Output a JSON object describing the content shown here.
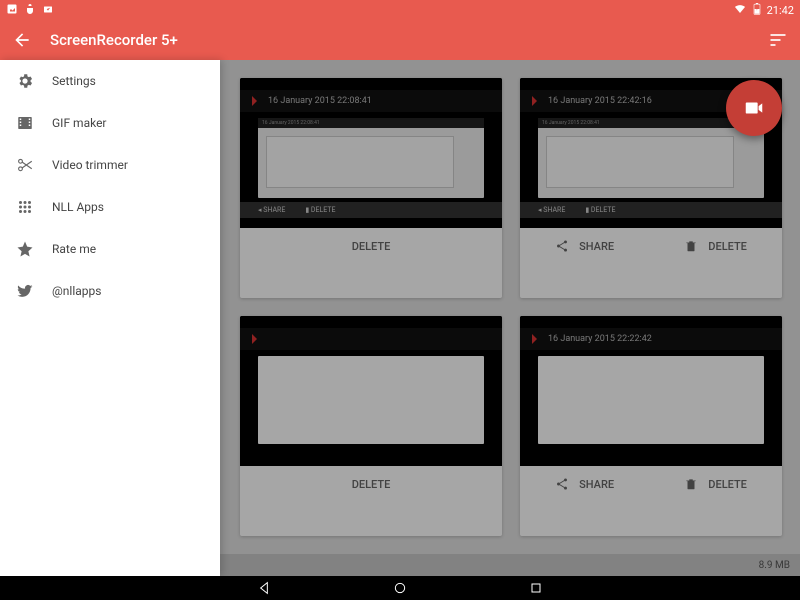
{
  "status": {
    "time": "21:42"
  },
  "toolbar": {
    "title": "ScreenRecorder 5+"
  },
  "drawer": {
    "items": [
      {
        "label": "Settings",
        "icon": "settings"
      },
      {
        "label": "GIF maker",
        "icon": "film"
      },
      {
        "label": "Video trimmer",
        "icon": "scissors"
      },
      {
        "label": "NLL Apps",
        "icon": "apps"
      },
      {
        "label": "Rate me",
        "icon": "star"
      },
      {
        "label": "@nllapps",
        "icon": "twitter"
      }
    ]
  },
  "recordings": [
    {
      "date": "16 January 2015 22:08:41",
      "inner_date": "16 January 2015 22:08:41"
    },
    {
      "date": "16 January 2015 22:42:16",
      "inner_date": "16 January 2015 22:08:41"
    },
    {
      "date": "",
      "inner_date": ""
    },
    {
      "date": "16 January 2015 22:22:42",
      "inner_date": ""
    }
  ],
  "actions": {
    "share": "SHARE",
    "delete": "DELETE"
  },
  "storage": "8.9 MB"
}
